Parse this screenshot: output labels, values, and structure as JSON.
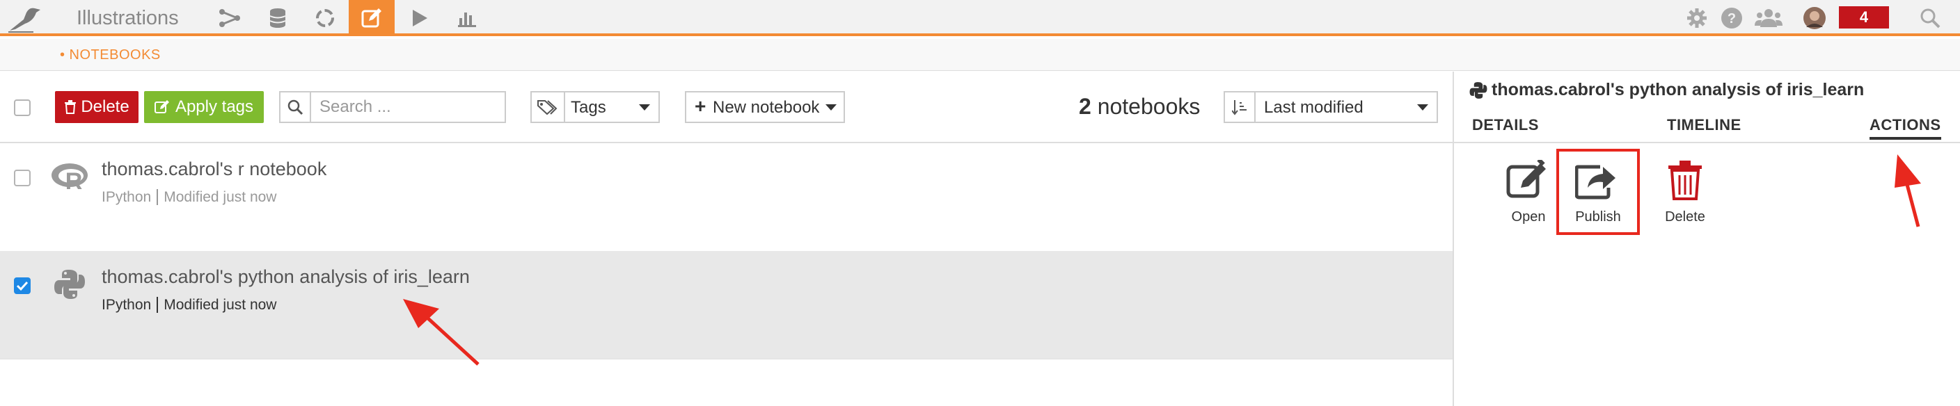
{
  "topbar": {
    "project_name": "Illustrations",
    "nav_icons": [
      "flow-icon",
      "datasets-icon",
      "recipes-icon",
      "notebooks-icon",
      "jobs-icon",
      "dashboards-icon"
    ],
    "right_icons": [
      "gear-icon",
      "help-icon",
      "users-icon",
      "avatar",
      "search-icon"
    ],
    "notification_count": "4",
    "accent": "#f38b34"
  },
  "breadcrumb": {
    "label": "• NOTEBOOKS"
  },
  "toolbar": {
    "delete_label": "Delete",
    "apply_tags_label": "Apply tags",
    "search_placeholder": "Search ...",
    "tags_label": "Tags",
    "new_notebook_label": "New notebook",
    "count_number": "2",
    "count_label": "notebooks",
    "sort_label": "Last modified"
  },
  "notebooks": [
    {
      "title": "thomas.cabrol's r notebook",
      "kernel": "IPython",
      "modified": "Modified just now",
      "language": "r",
      "selected": false
    },
    {
      "title": "thomas.cabrol's python analysis of iris_learn",
      "kernel": "IPython",
      "modified": "Modified just now",
      "language": "python",
      "selected": true
    }
  ],
  "detail": {
    "title": "thomas.cabrol's python analysis of iris_learn",
    "tabs": [
      "DETAILS",
      "TIMELINE",
      "ACTIONS"
    ],
    "active_tab": "ACTIONS",
    "actions": [
      {
        "label": "Open",
        "icon": "edit-icon",
        "color": "#333333"
      },
      {
        "label": "Publish",
        "icon": "share-icon",
        "color": "#333333"
      },
      {
        "label": "Delete",
        "icon": "trash-icon",
        "color": "#c3161c"
      }
    ]
  }
}
